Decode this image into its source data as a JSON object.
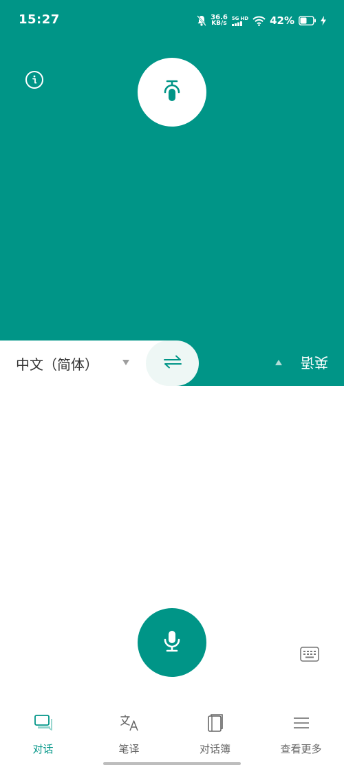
{
  "status_bar": {
    "time": "15:27",
    "net_speed_value": "36.6",
    "net_speed_unit": "KB/s",
    "network_type": "5G",
    "network_hd": "HD",
    "battery_percent": "42%"
  },
  "top_panel": {
    "info_icon": "info-icon",
    "mic_icon": "microphone-icon"
  },
  "language_bar": {
    "source_language": "中文（简体）",
    "target_language": "英语"
  },
  "bottom_nav": {
    "items": [
      {
        "label": "对话",
        "icon": "chat-bubbles-icon",
        "active": true
      },
      {
        "label": "笔译",
        "icon": "translate-icon",
        "active": false
      },
      {
        "label": "对话簿",
        "icon": "phrasebook-icon",
        "active": false
      },
      {
        "label": "查看更多",
        "icon": "menu-icon",
        "active": false
      }
    ]
  },
  "colors": {
    "primary": "#009587",
    "swap_bg": "#eef7f5",
    "inactive_text": "#666666"
  }
}
